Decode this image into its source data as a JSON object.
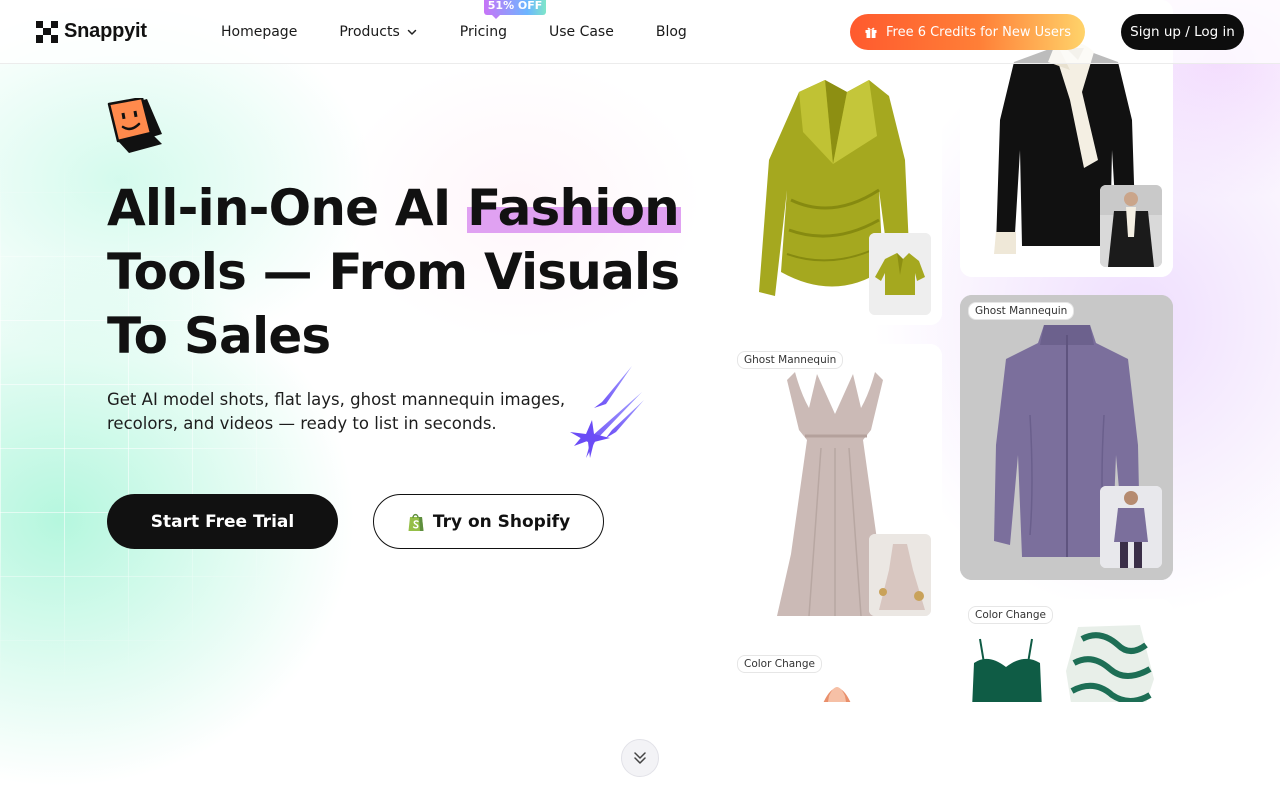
{
  "brand": {
    "name": "Snappyit"
  },
  "nav": {
    "items": [
      {
        "label": "Homepage"
      },
      {
        "label": "Products"
      },
      {
        "label": "Pricing",
        "badge": "51% OFF"
      },
      {
        "label": "Use Case"
      },
      {
        "label": "Blog"
      }
    ],
    "credits_label": "Free 6 Credits for New Users",
    "signup_label": "Sign up / Log in"
  },
  "hero": {
    "title_part1": "All-in-One AI ",
    "title_highlight": "Fashion",
    "title_part2": "Tools — From Visuals To Sales",
    "subtitle": "Get AI model shots, flat lays, ghost mannequin images, recolors, and videos — ready to list in seconds.",
    "primary_cta": "Start Free Trial",
    "secondary_cta": "Try on Shopify"
  },
  "gallery": {
    "tags": {
      "ghost_dress": "Ghost Mannequin",
      "ghost_jacket": "Ghost Mannequin",
      "color_change_left": "Color Change",
      "color_change_right": "Color Change"
    }
  },
  "colors": {
    "highlight": "#e0a1f2",
    "credits_gradient_start": "#ff5a2e",
    "credits_gradient_end": "#ffd36a",
    "primary_button": "#111111"
  },
  "icons": {
    "brand": "checker-logo-icon",
    "mascot": "smiley-cube-icon",
    "dropdown": "chevron-down-icon",
    "gift": "gift-icon",
    "shopify": "shopify-bag-icon",
    "sparkles": "sparkles-icon",
    "scroll": "double-chevron-down-icon"
  }
}
